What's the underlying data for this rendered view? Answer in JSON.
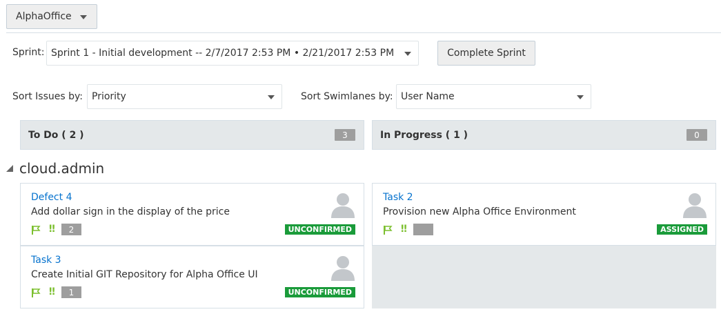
{
  "project": {
    "label": "AlphaOffice"
  },
  "sprint": {
    "label": "Sprint:",
    "selected": "Sprint 1 - Initial development -- 2/7/2017 2:53 PM • 2/21/2017 2:53 PM",
    "complete_label": "Complete Sprint"
  },
  "sort": {
    "issues_label": "Sort Issues by:",
    "issues_value": "Priority",
    "swimlanes_label": "Sort Swimlanes by:",
    "swimlanes_value": "User Name"
  },
  "columns": [
    {
      "title": "To Do ( 2 )",
      "badge": "3"
    },
    {
      "title": "In Progress ( 1 )",
      "badge": "0"
    }
  ],
  "swimlane": {
    "title": "cloud.admin"
  },
  "cards": [
    {
      "id": "Defect 4",
      "title": "Add dollar sign in the display of the price",
      "points": "2",
      "status": "UNCONFIRMED"
    },
    {
      "id": "Task 3",
      "title": "Create Initial GIT Repository for Alpha Office UI",
      "points": "1",
      "status": "UNCONFIRMED"
    },
    {
      "id": "Task 2",
      "title": "Provision new Alpha Office Environment",
      "points": "",
      "status": "ASSIGNED"
    }
  ],
  "colors": {
    "accent": "#0572ce",
    "status_green": "#1a9b3a",
    "priority_green": "#7cbf2f",
    "badge_gray": "#9e9e9e"
  },
  "icons": [
    "chevron-down-icon",
    "collapse-triangle-icon",
    "flag-icon",
    "priority-icon",
    "avatar-icon"
  ]
}
